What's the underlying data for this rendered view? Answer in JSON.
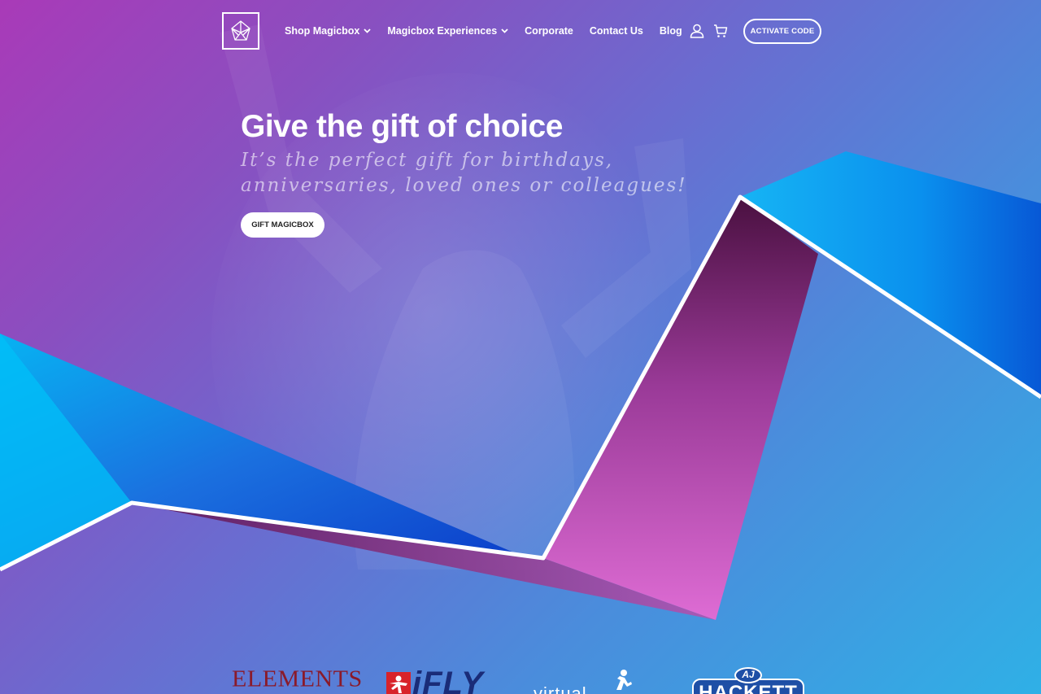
{
  "nav": {
    "logo_alt": "Magicbox logo",
    "items": [
      {
        "label": "Shop Magicbox",
        "dropdown": true
      },
      {
        "label": "Magicbox Experiences",
        "dropdown": true
      },
      {
        "label": "Corporate",
        "dropdown": false
      },
      {
        "label": "Contact Us",
        "dropdown": false
      },
      {
        "label": "Blog",
        "dropdown": false
      }
    ],
    "account_icon": "user-icon",
    "cart_icon": "cart-icon",
    "activate_label": "ACTIVATE CODE"
  },
  "hero": {
    "title": "Give the gift of choice",
    "subtitle": "It’s the perfect gift for birthdays, anniversaries, loved ones or colleagues!",
    "cta_label": "GIFT MAGICBOX"
  },
  "partners": {
    "elements": "ELEMENTS",
    "ifly": "iFLY",
    "virtual": "virtual",
    "hackett": "HACKETT",
    "hackett_initials": "AJ"
  },
  "colors": {
    "brand_magenta": "#a93ab8",
    "brand_blue": "#2fb0e6",
    "ribbon_dark": "#4a1040",
    "ribbon_pink": "#d861c8"
  }
}
